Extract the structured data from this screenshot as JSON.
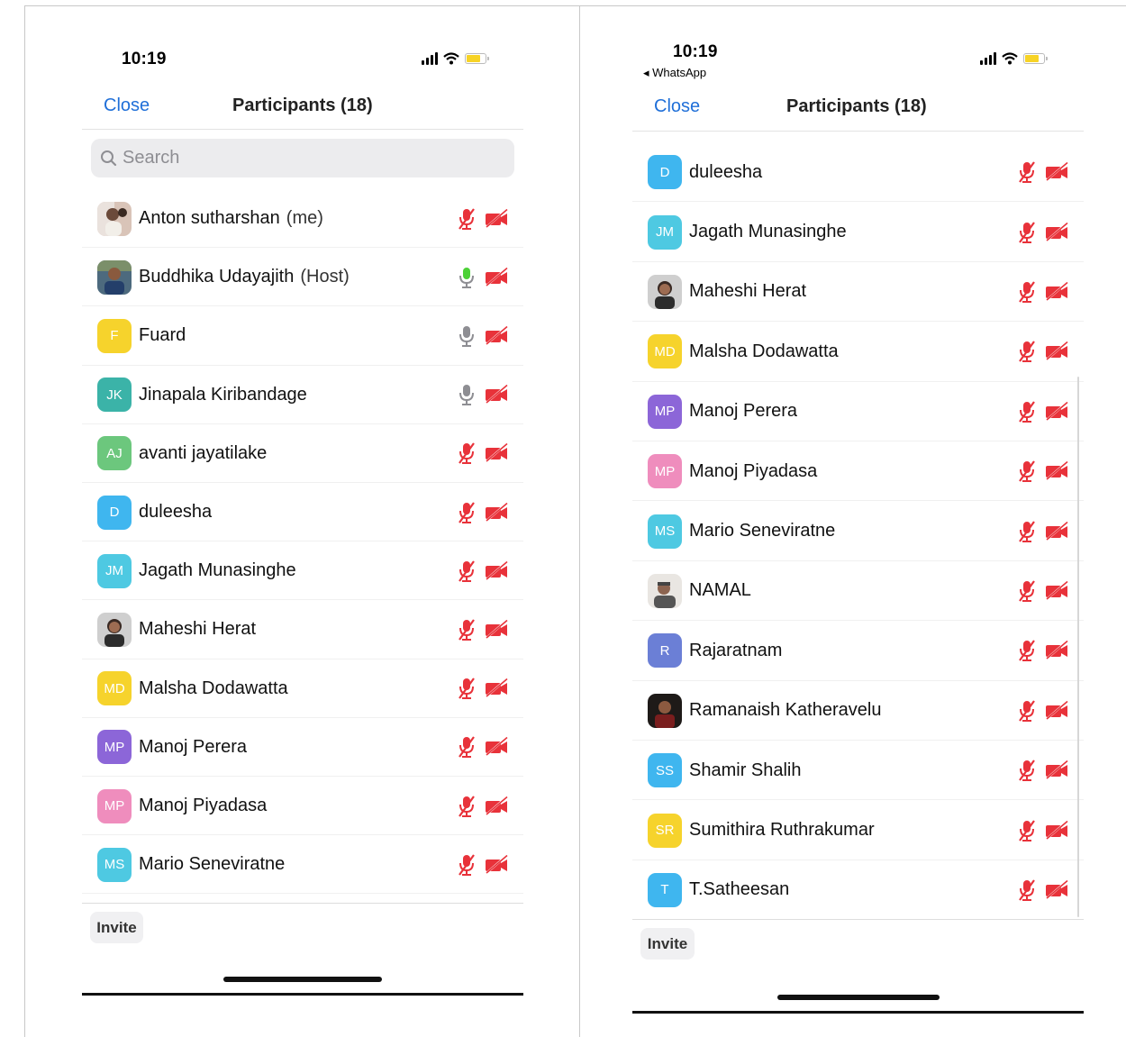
{
  "left_screen": {
    "status_time": "10:19",
    "close_label": "Close",
    "title": "Participants (18)",
    "search_placeholder": "Search",
    "invite_label": "Invite",
    "participants": [
      {
        "name": "Anton sutharshan",
        "tag": "(me)",
        "avatar": "photo",
        "mic": "muted"
      },
      {
        "name": "Buddhika Udayajith",
        "tag": "(Host)",
        "avatar": "photo",
        "mic": "active"
      },
      {
        "name": "Fuard",
        "avatar": "F",
        "color": "#f6d32c",
        "mic": "unmuted"
      },
      {
        "name": "Jinapala Kiribandage",
        "avatar": "JK",
        "color": "#3bb3a8",
        "mic": "unmuted"
      },
      {
        "name": "avanti jayatilake",
        "avatar": "AJ",
        "color": "#6cc77d",
        "mic": "muted"
      },
      {
        "name": "duleesha",
        "avatar": "D",
        "color": "#3fb6ef",
        "mic": "muted"
      },
      {
        "name": "Jagath Munasinghe",
        "avatar": "JM",
        "color": "#4ec9e2",
        "mic": "muted"
      },
      {
        "name": "Maheshi Herat",
        "avatar": "photo",
        "mic": "muted"
      },
      {
        "name": "Malsha Dodawatta",
        "avatar": "MD",
        "color": "#f6d32c",
        "mic": "muted"
      },
      {
        "name": "Manoj Perera",
        "avatar": "MP",
        "color": "#8c66d8",
        "mic": "muted"
      },
      {
        "name": "Manoj Piyadasa",
        "avatar": "MP",
        "color": "#ef8dbd",
        "mic": "muted"
      },
      {
        "name": "Mario Seneviratne",
        "avatar": "MS",
        "color": "#4ec9e2",
        "mic": "muted"
      }
    ]
  },
  "right_screen": {
    "status_time": "10:19",
    "back_app": "◂ WhatsApp",
    "close_label": "Close",
    "title": "Participants (18)",
    "invite_label": "Invite",
    "participants": [
      {
        "name": "duleesha",
        "avatar": "D",
        "color": "#3fb6ef",
        "mic": "muted"
      },
      {
        "name": "Jagath Munasinghe",
        "avatar": "JM",
        "color": "#4ec9e2",
        "mic": "muted"
      },
      {
        "name": "Maheshi Herat",
        "avatar": "photo",
        "mic": "muted"
      },
      {
        "name": "Malsha Dodawatta",
        "avatar": "MD",
        "color": "#f6d32c",
        "mic": "muted"
      },
      {
        "name": "Manoj Perera",
        "avatar": "MP",
        "color": "#8c66d8",
        "mic": "muted"
      },
      {
        "name": "Manoj Piyadasa",
        "avatar": "MP",
        "color": "#ef8dbd",
        "mic": "muted"
      },
      {
        "name": "Mario Seneviratne",
        "avatar": "MS",
        "color": "#4ec9e2",
        "mic": "muted"
      },
      {
        "name": "NAMAL",
        "avatar": "photo",
        "mic": "muted"
      },
      {
        "name": "Rajaratnam",
        "avatar": "R",
        "color": "#6b7fd6",
        "mic": "muted"
      },
      {
        "name": "Ramanaish Katheravelu",
        "avatar": "photo",
        "mic": "muted"
      },
      {
        "name": "Shamir Shalih",
        "avatar": "SS",
        "color": "#3fb6ef",
        "mic": "muted"
      },
      {
        "name": "Sumithira Ruthrakumar",
        "avatar": "SR",
        "color": "#f6d32c",
        "mic": "muted"
      },
      {
        "name": "T.Satheesan",
        "avatar": "T",
        "color": "#3fb6ef",
        "mic": "muted"
      }
    ]
  },
  "icons": {
    "search": "search-icon",
    "mic_muted": "mic-muted-icon",
    "mic_active": "mic-icon",
    "video_off": "video-off-icon",
    "signal": "cellular-signal-icon",
    "wifi": "wifi-icon",
    "battery": "battery-icon"
  },
  "colors": {
    "accent_blue": "#1f6fd8",
    "muted_red": "#e8323a",
    "mic_green": "#4cd137",
    "mic_gray": "#8e8e93"
  }
}
